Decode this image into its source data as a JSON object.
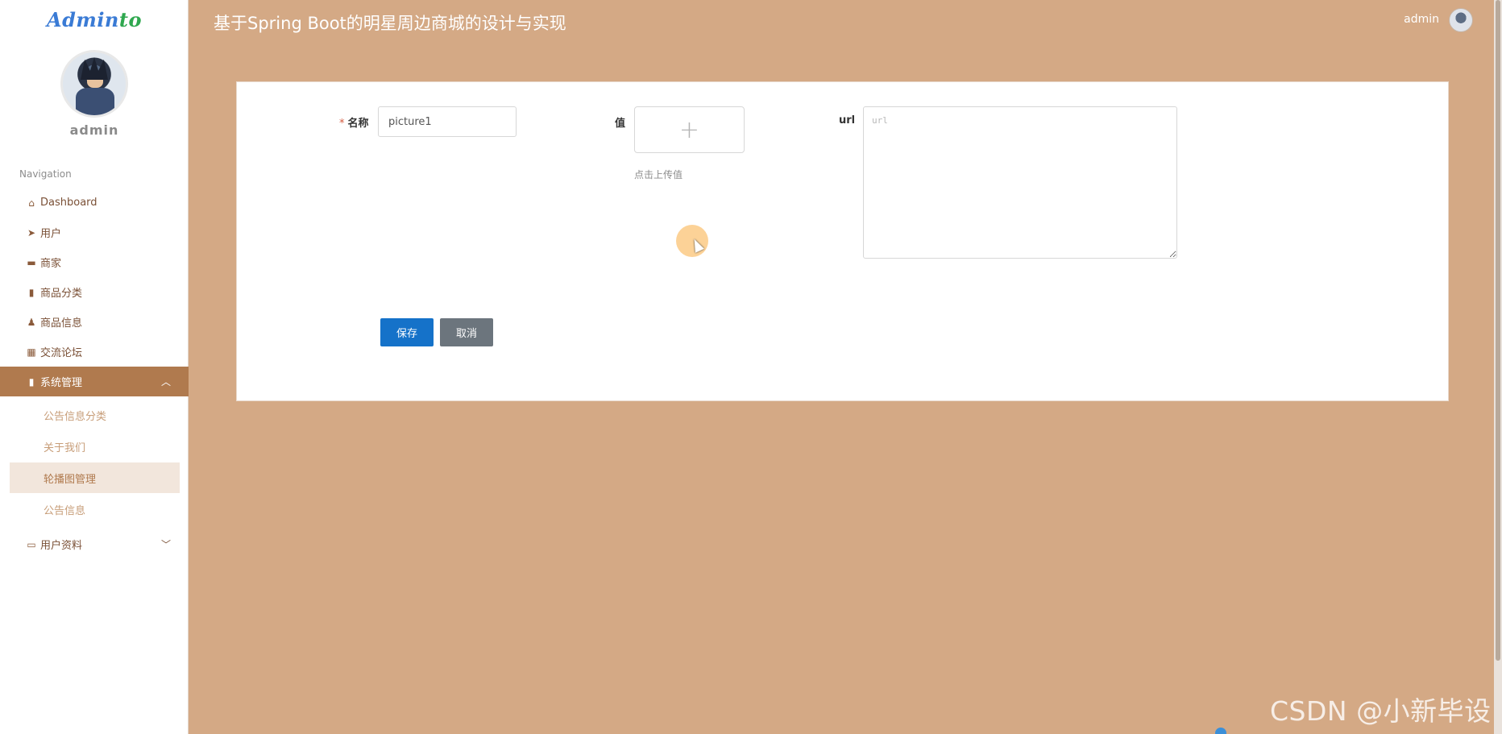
{
  "app": {
    "logo_part1": "Admin",
    "logo_part2": "to",
    "title": "基于Spring Boot的明星周边商城的设计与实现"
  },
  "header": {
    "username": "admin",
    "avatar_icon": "user-avatar"
  },
  "sidebar": {
    "username": "admin",
    "nav_title": "Navigation",
    "items": [
      {
        "label": "Dashboard",
        "icon": "home-icon"
      },
      {
        "label": "用户",
        "icon": "paper-plane-icon"
      },
      {
        "label": "商家",
        "icon": "briefcase-icon"
      },
      {
        "label": "商品分类",
        "icon": "book-icon"
      },
      {
        "label": "商品信息",
        "icon": "user-icon"
      },
      {
        "label": "交流论坛",
        "icon": "grid-icon"
      },
      {
        "label": "系统管理",
        "icon": "bar-chart-icon",
        "expanded": true
      },
      {
        "label": "用户资料",
        "icon": "card-icon",
        "expanded": false
      }
    ],
    "sub_items": [
      {
        "label": "公告信息分类"
      },
      {
        "label": "关于我们"
      },
      {
        "label": "轮播图管理",
        "selected": true
      },
      {
        "label": "公告信息"
      }
    ]
  },
  "form": {
    "name_label": "名称",
    "required_mark": "*",
    "name_value": "picture1",
    "value_label": "值",
    "upload_plus": "+",
    "upload_tip": "点击上传值",
    "url_label": "url",
    "url_placeholder": "url",
    "save_label": "保存",
    "cancel_label": "取消"
  },
  "watermark": "CSDN @小新毕设",
  "colors": {
    "background": "#d4a985",
    "sidebar_active": "#b07a4e",
    "primary_button": "#1572c9",
    "secondary_button": "#6c757d"
  }
}
